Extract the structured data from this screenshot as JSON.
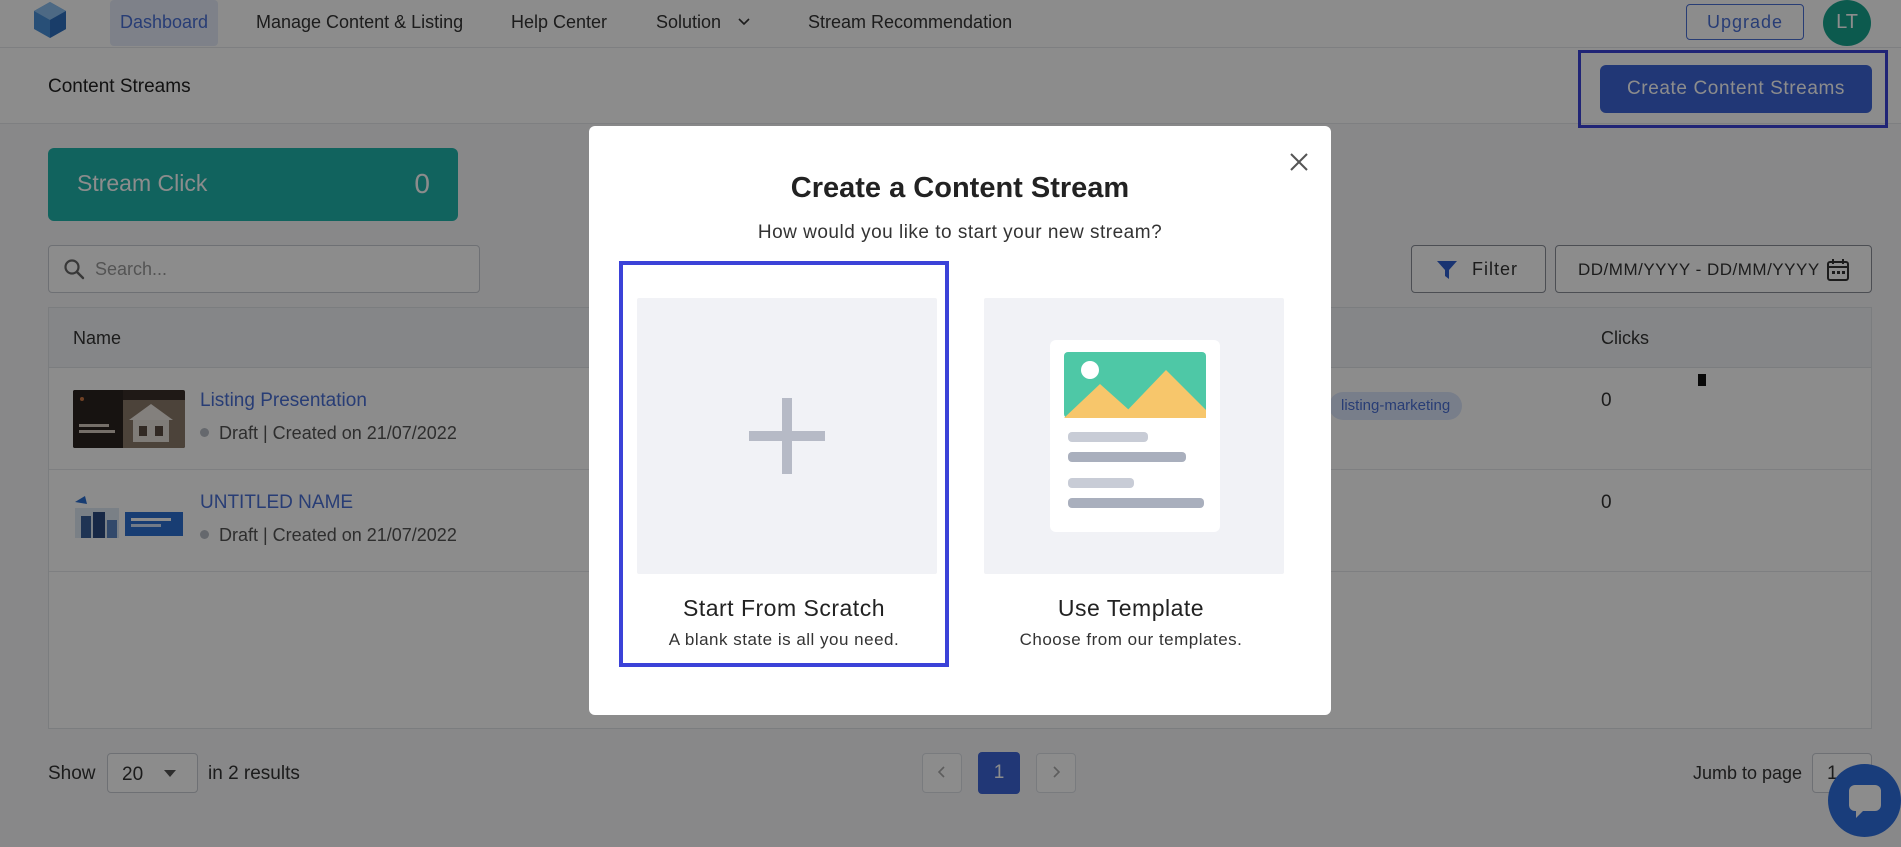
{
  "nav": {
    "items": [
      {
        "label": "Dashboard",
        "active": true
      },
      {
        "label": "Manage Content & Listing"
      },
      {
        "label": "Help Center"
      },
      {
        "label": "Solution"
      },
      {
        "label": "Stream Recommendation"
      }
    ],
    "upgrade_label": "Upgrade",
    "avatar_initials": "LT"
  },
  "header": {
    "title": "Content Streams",
    "create_label": "Create Content Streams"
  },
  "stat": {
    "label": "Stream Click",
    "value": "0"
  },
  "search": {
    "placeholder": "Search..."
  },
  "filter": {
    "label": "Filter",
    "date_placeholder": "DD/MM/YYYY - DD/MM/YYYY"
  },
  "table": {
    "columns": [
      "Name",
      "Clicks"
    ],
    "rows": [
      {
        "title": "Listing Presentation",
        "meta": "Draft | Created on 21/07/2022",
        "tag": "listing-marketing",
        "clicks": "0"
      },
      {
        "title": "UNTITLED NAME",
        "meta": "Draft | Created on 21/07/2022",
        "clicks": "0"
      }
    ]
  },
  "footer": {
    "show_label": "Show",
    "page_size": "20",
    "results": "in 2 results",
    "current_page": "1",
    "jump_label": "Jumb to page",
    "jump_value": "1"
  },
  "modal": {
    "title": "Create a Content Stream",
    "subtitle": "How would you like to start your new stream?",
    "options": [
      {
        "label": "Start From Scratch",
        "desc": "A blank state is all you need."
      },
      {
        "label": "Use Template",
        "desc": "Choose from our templates."
      }
    ]
  },
  "colors": {
    "primary": "#3d64d8",
    "teal": "#1fb4ab",
    "avatar": "#16a58f",
    "highlight": "#3b42d8"
  }
}
